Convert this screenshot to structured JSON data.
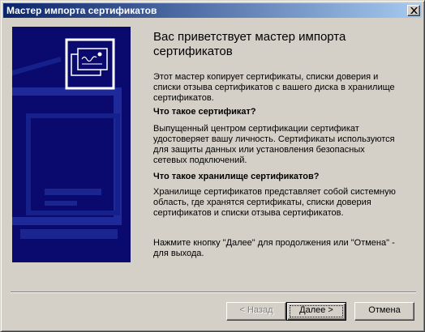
{
  "window": {
    "title": "Мастер импорта сертификатов"
  },
  "main": {
    "welcome": "Вас приветствует мастер импорта сертификатов",
    "intro": "Этот мастер копирует сертификаты, списки доверия и списки отзыва сертификатов с вашего диска в хранилище сертификатов.",
    "q1_heading": "Что такое сертификат?",
    "q1_text": "Выпущенный центром сертификации сертификат удостоверяет вашу личность. Сертификаты используются для защиты данных или установления безопасных сетевых подключений.",
    "q2_heading": "Что такое хранилище сертификатов?",
    "q2_text": "Хранилище сертификатов представляет собой системную область, где хранятся сертификаты, списки доверия сертификатов и списки отзыва сертификатов.",
    "footer_text": "Нажмите кнопку \"Далее\" для продолжения или \"Отмена\" - для выхода."
  },
  "buttons": {
    "back": "< Назад",
    "next": "Далее >",
    "cancel": "Отмена"
  },
  "colors": {
    "titlebar_start": "#0a246a",
    "titlebar_end": "#a6caf0",
    "banner": "#0a0a6e",
    "dialog_bg": "#d4d0c8"
  },
  "icons": {
    "banner": "certificate-icon",
    "close": "close-icon"
  }
}
